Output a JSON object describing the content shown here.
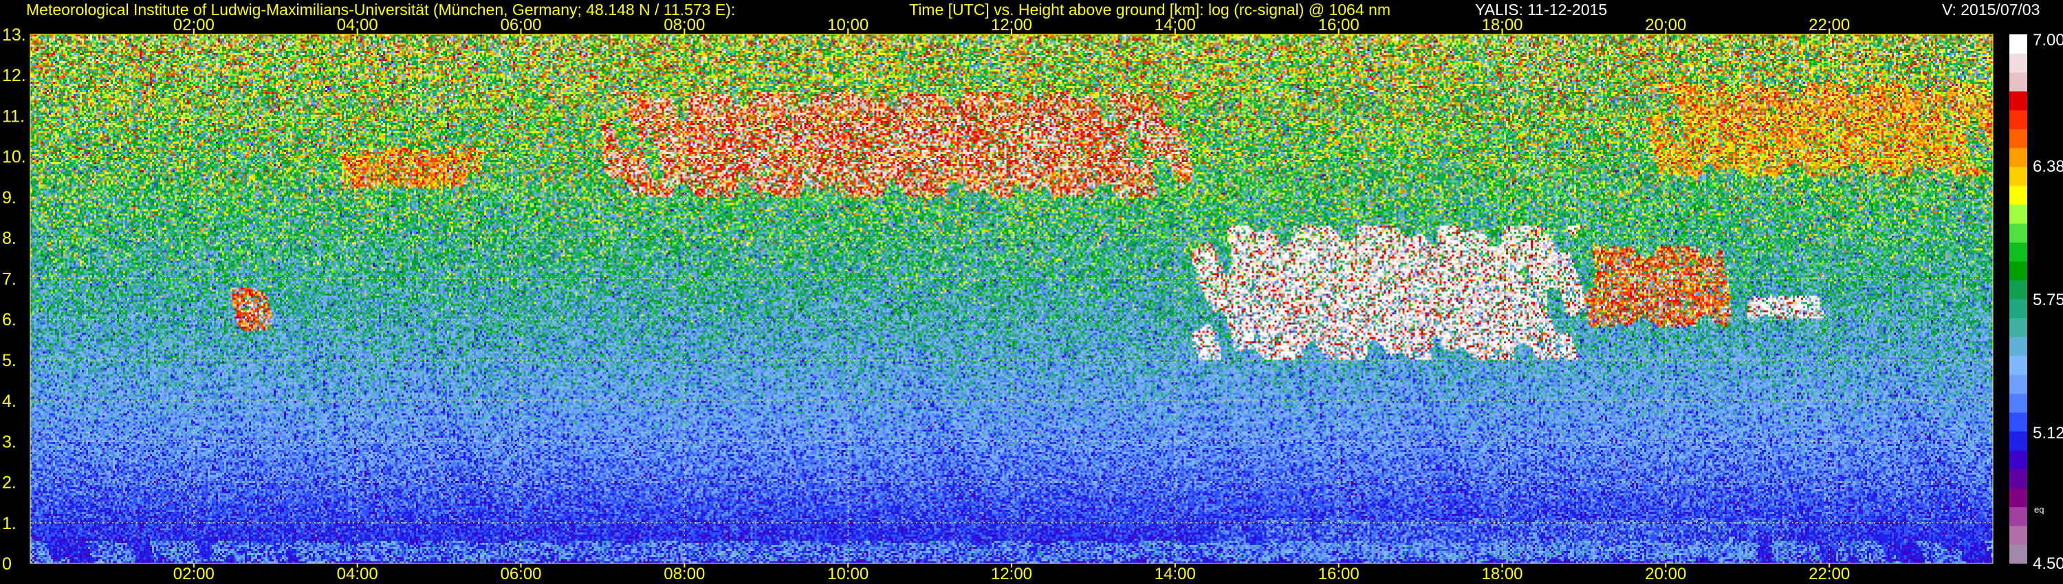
{
  "header": {
    "institute": "Meteorological Institute of Ludwig-Maximilians-Universität (München, Germany; 48.148 N / 11.573 E):",
    "description": "Time [UTC] vs. Height above ground [km]: log (rc-signal) @ 1064 nm",
    "instrument_date": "YALIS: 11-12-2015",
    "version": "V: 2015/07/03"
  },
  "colors": {
    "background": "#000000",
    "axis_text": "#ffff00",
    "grid": "#ffff00",
    "colorbar_text": "#ffffff"
  },
  "chart_data": {
    "type": "heatmap",
    "x_tick_labels": [
      "02:00",
      "04:00",
      "06:00",
      "08:00",
      "10:00",
      "12:00",
      "14:00",
      "16:00",
      "18:00",
      "20:00",
      "22:00"
    ],
    "x_tick_hours": [
      2,
      4,
      6,
      8,
      10,
      12,
      14,
      16,
      18,
      20,
      22
    ],
    "xlim_hours": [
      0,
      24
    ],
    "y_tick_labels": [
      "0",
      "1.",
      "2.",
      "3.",
      "4.",
      "5.",
      "6.",
      "7.",
      "8.",
      "9.",
      "10.",
      "11.",
      "12.",
      "13."
    ],
    "y_tick_values": [
      0,
      1,
      2,
      3,
      4,
      5,
      6,
      7,
      8,
      9,
      10,
      11,
      12,
      13
    ],
    "ylim_km": [
      0,
      13
    ],
    "grid": true,
    "colorbar": {
      "tick_labels": [
        "7.00",
        "6.38",
        "5.75",
        "5.12",
        "4.50"
      ],
      "tick_values": [
        7.0,
        6.38,
        5.75,
        5.12,
        4.5
      ],
      "range": [
        4.5,
        7.0
      ],
      "side_label": "eq",
      "colors_bottom_to_top": [
        "#a08aa8",
        "#b070a8",
        "#a040a0",
        "#800080",
        "#6000a0",
        "#3c00c8",
        "#2020e8",
        "#3050ff",
        "#5080ff",
        "#70a0ff",
        "#80b8ff",
        "#60b0d8",
        "#40b0a0",
        "#20a880",
        "#10a050",
        "#00a000",
        "#10c020",
        "#50e040",
        "#a0ff40",
        "#ffff00",
        "#ffd000",
        "#ffa000",
        "#ff6000",
        "#ff3000",
        "#e00000",
        "#e8c0c8",
        "#f0dde0",
        "#ffffff"
      ]
    },
    "features": [
      {
        "kind": "boundary layer",
        "t_start_h": 0.0,
        "t_end_h": 24.0,
        "h_bottom_km": 0.0,
        "h_top_km": 0.55,
        "intensity": 5.3
      },
      {
        "kind": "boundary layer (afternoon)",
        "t_start_h": 14.5,
        "t_end_h": 21.5,
        "h_bottom_km": 0.1,
        "h_top_km": 1.1,
        "intensity": 5.2
      },
      {
        "kind": "cirrus",
        "t_start_h": 7.0,
        "t_end_h": 14.2,
        "h_bottom_km": 9.0,
        "h_top_km": 11.6,
        "intensity": 6.7
      },
      {
        "kind": "cirrus",
        "t_start_h": 3.8,
        "t_end_h": 5.5,
        "h_bottom_km": 9.2,
        "h_top_km": 10.2,
        "intensity": 6.5
      },
      {
        "kind": "cirrus",
        "t_start_h": 19.8,
        "t_end_h": 24.0,
        "h_bottom_km": 9.5,
        "h_top_km": 11.8,
        "intensity": 6.4
      },
      {
        "kind": "mid-level cloud",
        "t_start_h": 14.2,
        "t_end_h": 19.0,
        "h_bottom_km": 5.0,
        "h_top_km": 8.3,
        "intensity": 6.9
      },
      {
        "kind": "mid-level cloud",
        "t_start_h": 19.0,
        "t_end_h": 20.8,
        "h_bottom_km": 5.8,
        "h_top_km": 7.8,
        "intensity": 6.6
      },
      {
        "kind": "mid-level cloud",
        "t_start_h": 2.45,
        "t_end_h": 2.95,
        "h_bottom_km": 5.7,
        "h_top_km": 6.8,
        "intensity": 6.6
      },
      {
        "kind": "mid-level cloud",
        "t_start_h": 21.0,
        "t_end_h": 22.0,
        "h_bottom_km": 6.0,
        "h_top_km": 6.6,
        "intensity": 6.9
      }
    ]
  }
}
